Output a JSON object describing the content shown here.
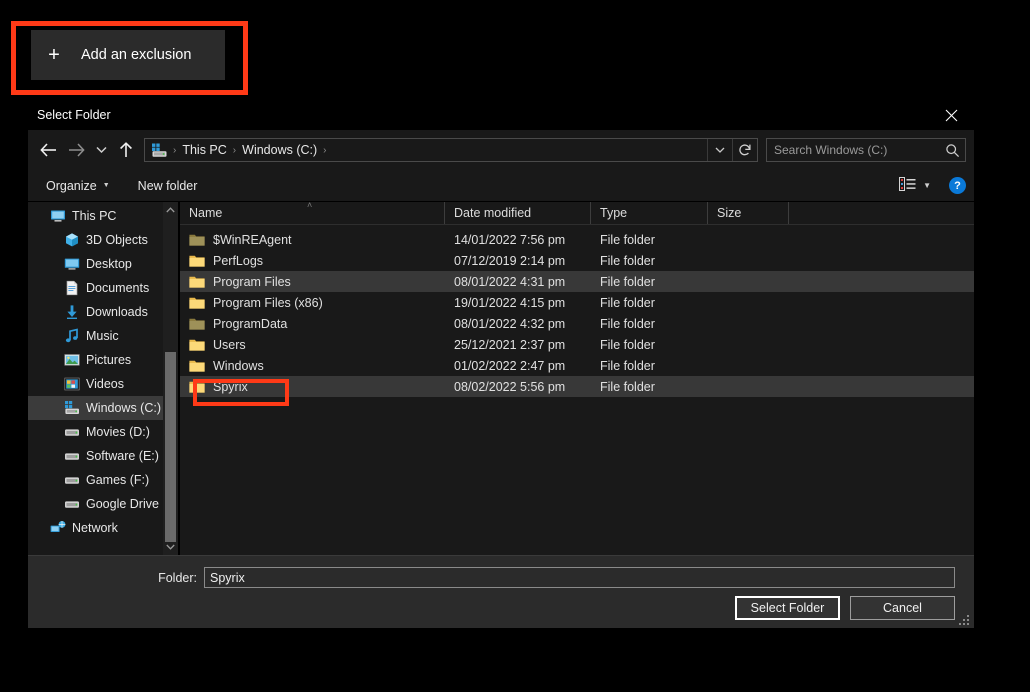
{
  "settings": {
    "add_exclusion_label": "Add an exclusion",
    "add_exclusion_plus": "+"
  },
  "dialog": {
    "title": "Select Folder",
    "close_icon": "close-icon",
    "nav": {
      "back_icon": "arrow-left-icon",
      "forward_icon": "arrow-right-icon",
      "recent_icon": "chevron-down-icon",
      "up_icon": "arrow-up-icon",
      "breadcrumb": [
        "This PC",
        "Windows (C:)"
      ],
      "breadcrumb_separator": "›",
      "address_dropdown_icon": "chevron-down-icon",
      "refresh_icon": "refresh-icon"
    },
    "search": {
      "placeholder": "Search Windows (C:)",
      "value": "",
      "icon": "search-icon"
    },
    "commandbar": {
      "organize_label": "Organize",
      "organize_caret": "▼",
      "new_folder_label": "New folder",
      "view_mode_icon": "list-view-icon",
      "view_caret": "▼",
      "help_label": "?"
    },
    "nav_tree": {
      "items": [
        {
          "label": "This PC",
          "icon": "this-pc-icon",
          "level": 0,
          "selected": false
        },
        {
          "label": "3D Objects",
          "icon": "3d-objects-icon",
          "level": 1,
          "selected": false
        },
        {
          "label": "Desktop",
          "icon": "desktop-icon",
          "level": 1,
          "selected": false
        },
        {
          "label": "Documents",
          "icon": "documents-icon",
          "level": 1,
          "selected": false
        },
        {
          "label": "Downloads",
          "icon": "downloads-icon",
          "level": 1,
          "selected": false
        },
        {
          "label": "Music",
          "icon": "music-icon",
          "level": 1,
          "selected": false
        },
        {
          "label": "Pictures",
          "icon": "pictures-icon",
          "level": 1,
          "selected": false
        },
        {
          "label": "Videos",
          "icon": "videos-icon",
          "level": 1,
          "selected": false
        },
        {
          "label": "Windows (C:)",
          "icon": "windows-drive-icon",
          "level": 1,
          "selected": true
        },
        {
          "label": "Movies (D:)",
          "icon": "drive-icon",
          "level": 1,
          "selected": false
        },
        {
          "label": "Software (E:)",
          "icon": "drive-icon",
          "level": 1,
          "selected": false
        },
        {
          "label": "Games (F:)",
          "icon": "drive-icon",
          "level": 1,
          "selected": false
        },
        {
          "label": "Google Drive (G:",
          "icon": "drive-icon",
          "level": 1,
          "selected": false
        },
        {
          "label": "Network",
          "icon": "network-icon",
          "level": 0,
          "selected": false
        }
      ],
      "scroll_up_icon": "chevron-up-icon",
      "scroll_down_icon": "chevron-down-icon"
    },
    "file_list": {
      "columns": [
        "Name",
        "Date modified",
        "Type",
        "Size"
      ],
      "sort_indicator": "˄",
      "rows": [
        {
          "name": "$WinREAgent",
          "date": "14/01/2022 7:56 pm",
          "type": "File folder",
          "size": "",
          "icon": "folder-dim-icon",
          "highlighted": false
        },
        {
          "name": "PerfLogs",
          "date": "07/12/2019 2:14 pm",
          "type": "File folder",
          "size": "",
          "icon": "folder-icon",
          "highlighted": false
        },
        {
          "name": "Program Files",
          "date": "08/01/2022 4:31 pm",
          "type": "File folder",
          "size": "",
          "icon": "folder-icon",
          "highlighted": true
        },
        {
          "name": "Program Files (x86)",
          "date": "19/01/2022 4:15 pm",
          "type": "File folder",
          "size": "",
          "icon": "folder-icon",
          "highlighted": false
        },
        {
          "name": "ProgramData",
          "date": "08/01/2022 4:32 pm",
          "type": "File folder",
          "size": "",
          "icon": "folder-dim-icon",
          "highlighted": false
        },
        {
          "name": "Users",
          "date": "25/12/2021 2:37 pm",
          "type": "File folder",
          "size": "",
          "icon": "folder-icon",
          "highlighted": false
        },
        {
          "name": "Windows",
          "date": "01/02/2022 2:47 pm",
          "type": "File folder",
          "size": "",
          "icon": "folder-icon",
          "highlighted": false
        },
        {
          "name": "Spyrix",
          "date": "08/02/2022 5:56 pm",
          "type": "File folder",
          "size": "",
          "icon": "folder-icon",
          "highlighted": true
        }
      ]
    },
    "footer": {
      "folder_label": "Folder:",
      "folder_value": "Spyrix",
      "select_folder_label": "Select Folder",
      "cancel_label": "Cancel",
      "resize_grip_icon": "resize-grip-icon"
    }
  },
  "annotations": {
    "color": "#ff3a17",
    "boxes": [
      "add-exclusion-highlight",
      "spyrix-row-highlight"
    ]
  }
}
